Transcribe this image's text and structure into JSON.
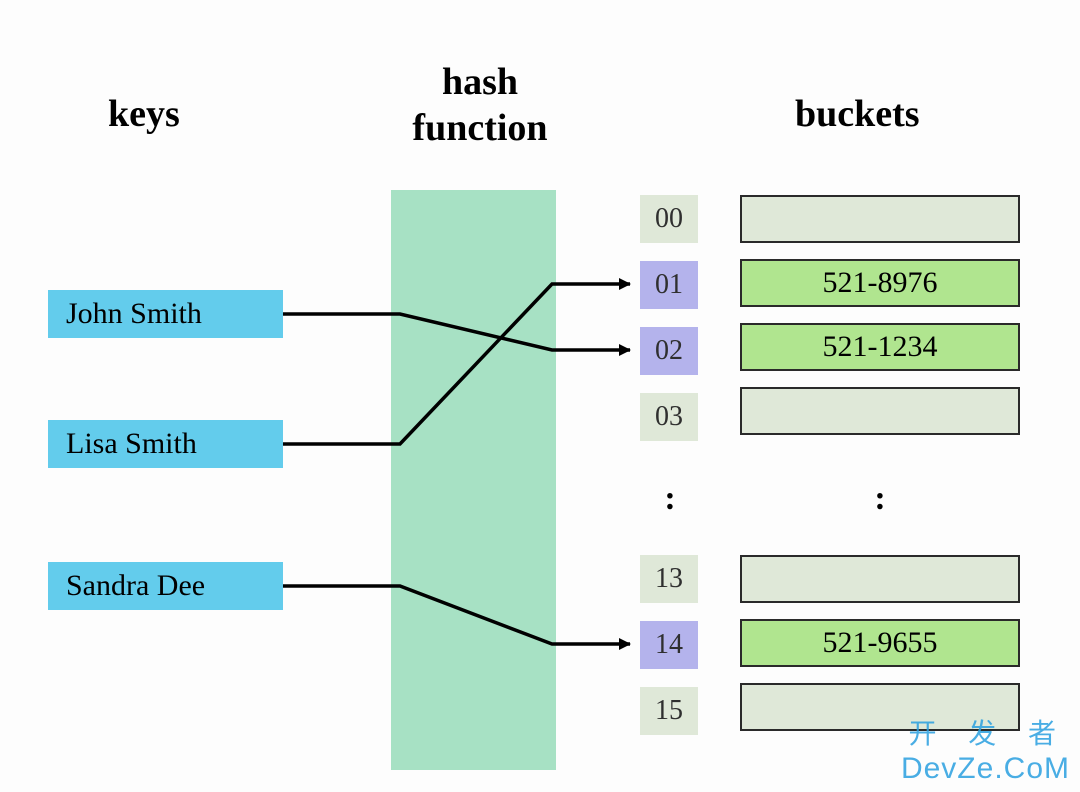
{
  "headings": {
    "keys": "keys",
    "hash_function_line1": "hash",
    "hash_function_line2": "function",
    "buckets": "buckets"
  },
  "keys": [
    {
      "name": "John Smith"
    },
    {
      "name": "Lisa Smith"
    },
    {
      "name": "Sandra Dee"
    }
  ],
  "ellipsis": ":",
  "index_cells": {
    "i00": "00",
    "i01": "01",
    "i02": "02",
    "i03": "03",
    "i13": "13",
    "i14": "14",
    "i15": "15"
  },
  "bucket_values": {
    "b01": "521-8976",
    "b02": "521-1234",
    "b14": "521-9655"
  },
  "mappings_description": "John Smith → bucket 02 (521-1234); Lisa Smith → bucket 01 (521-8976); Sandra Dee → bucket 14 (521-9655)",
  "watermark": {
    "cn": "开 发 者",
    "en": "DevZe.CoM"
  },
  "colors": {
    "key_bg": "#63ccec",
    "hashfn_bg": "#a7e1c4",
    "bucket_empty_bg": "#dfe8d8",
    "bucket_filled_bg": "#b0e58f",
    "index_active_bg": "#b4b3ec",
    "border": "#2a2a2a",
    "watermark": "#2aa0e0"
  }
}
